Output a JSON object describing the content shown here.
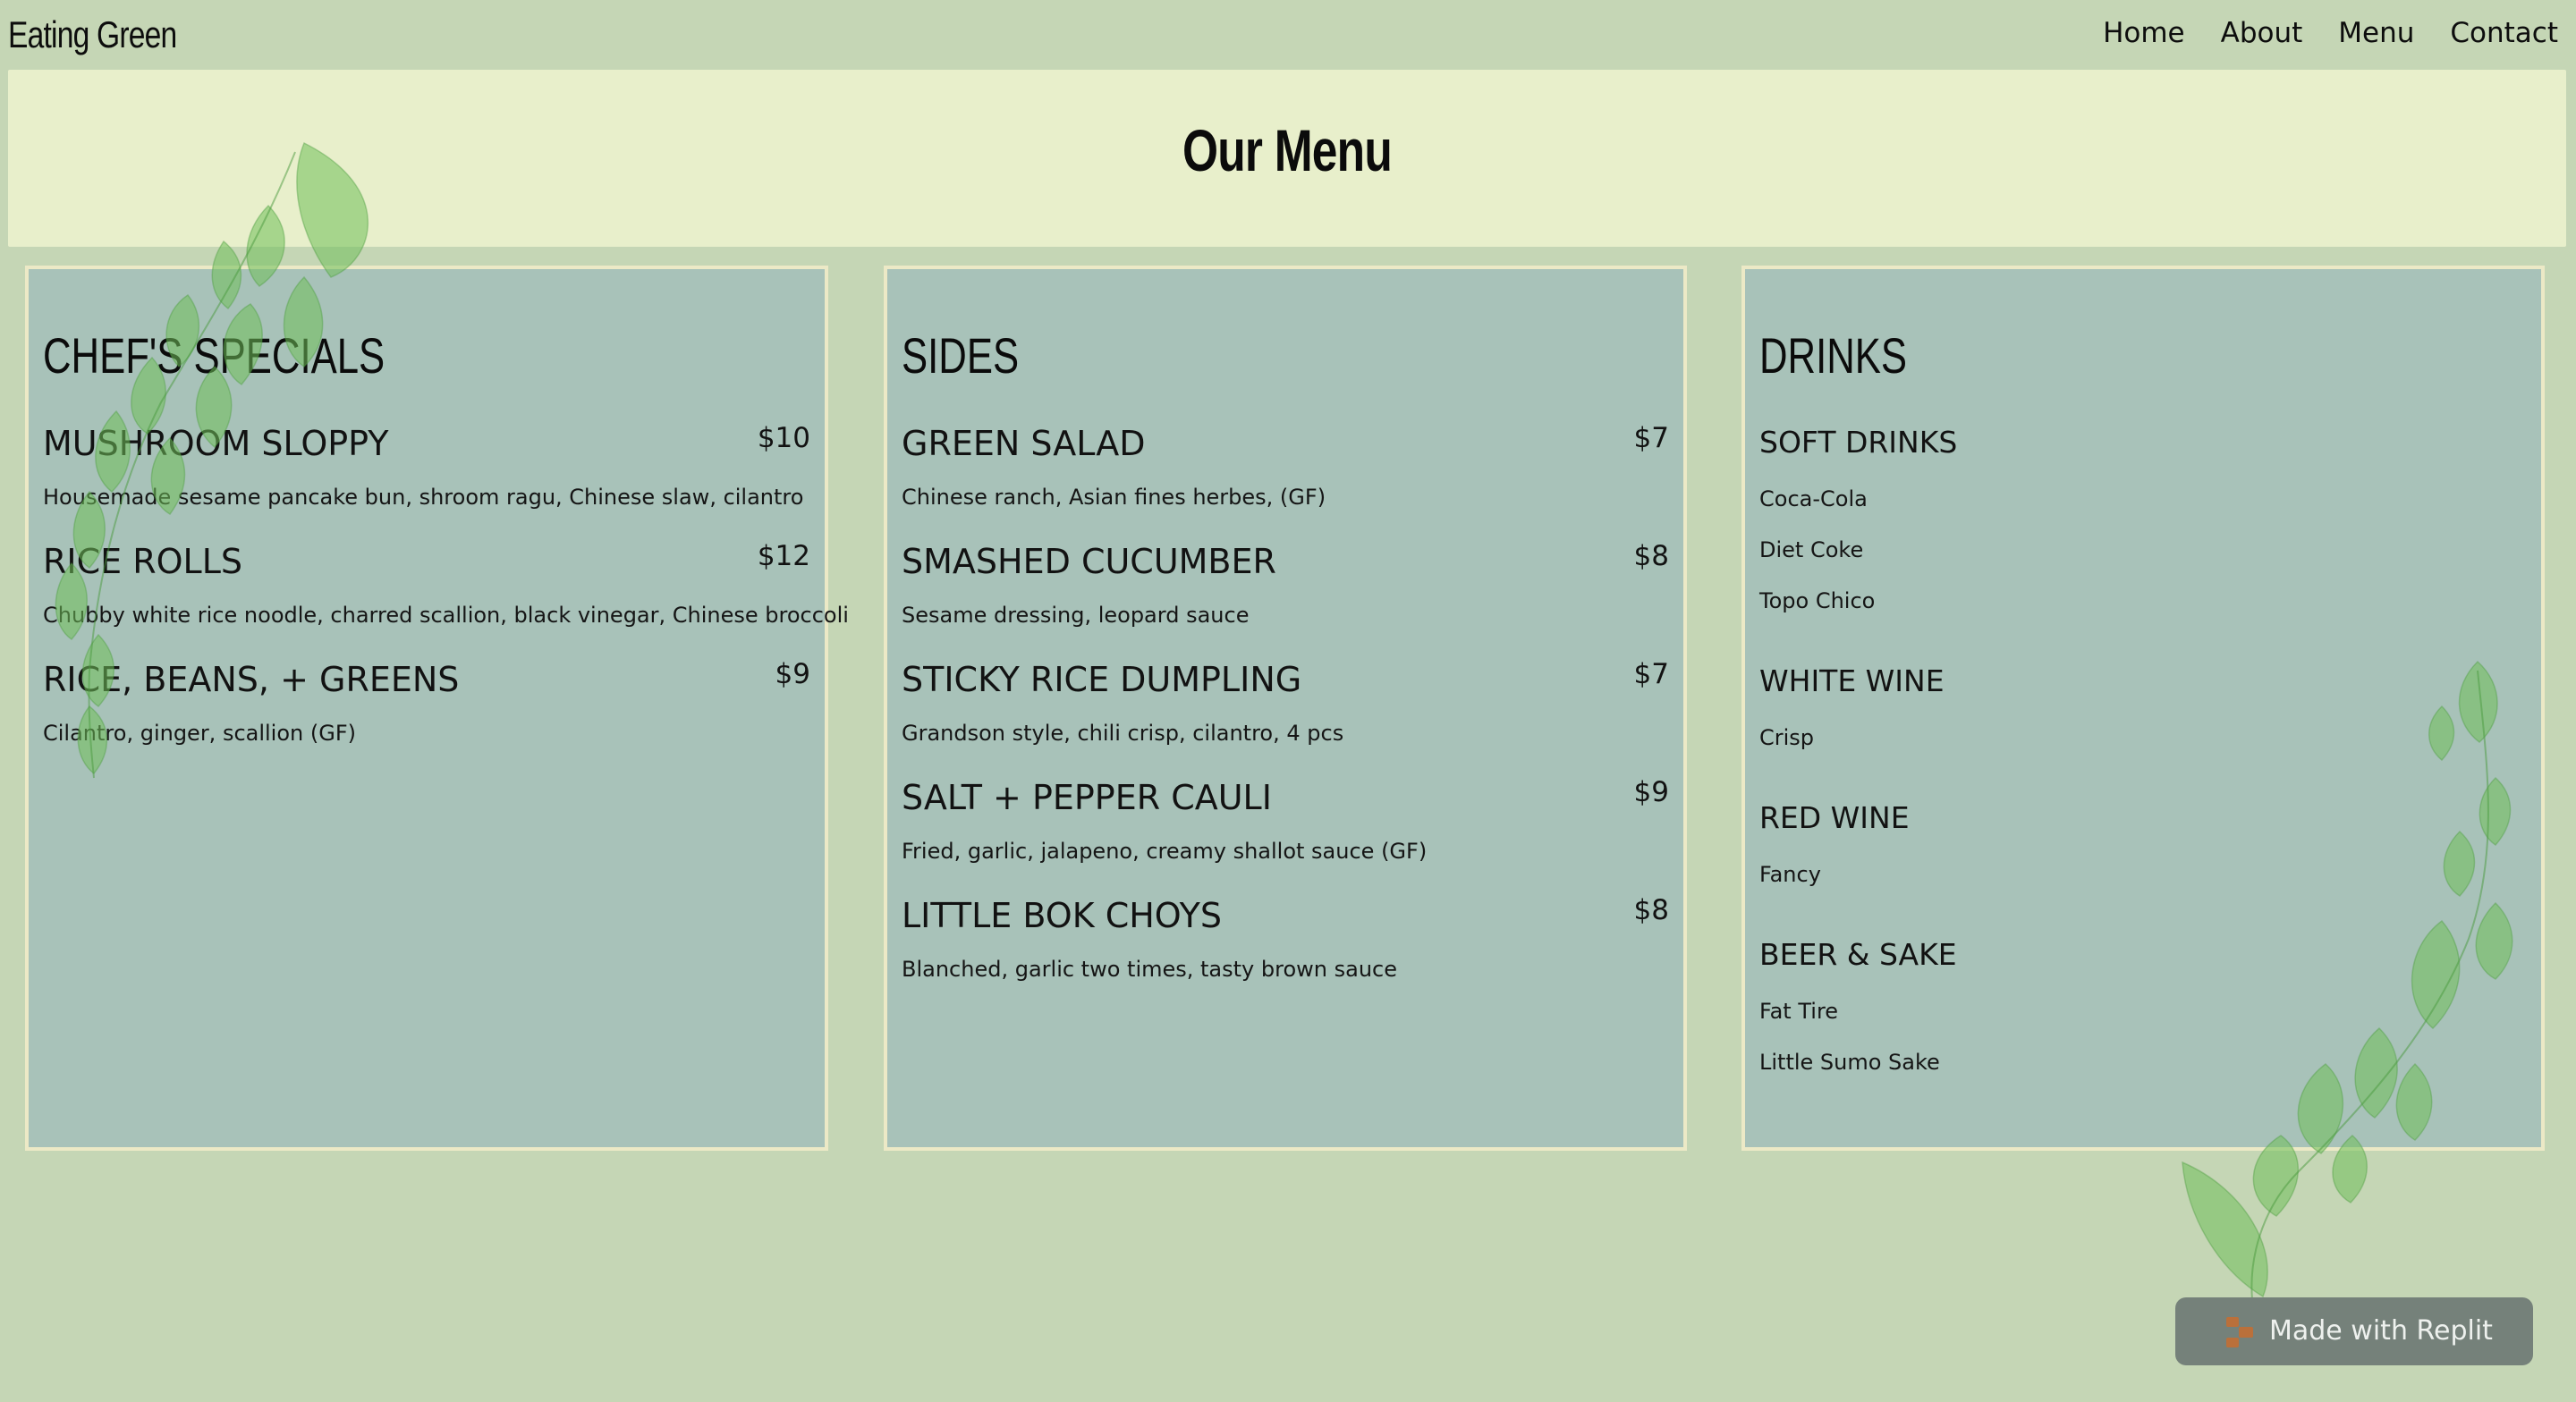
{
  "header": {
    "brand": "Eating Green",
    "nav": [
      "Home",
      "About",
      "Menu",
      "Contact"
    ]
  },
  "hero": {
    "title": "Our Menu"
  },
  "menu": {
    "chefs_specials": {
      "title": "CHEF'S SPECIALS",
      "items": [
        {
          "name": "MUSHROOM SLOPPY",
          "price": "$10",
          "desc": "Housemade sesame pancake bun, shroom ragu, Chinese slaw, cilantro"
        },
        {
          "name": "RICE ROLLS",
          "price": "$12",
          "desc": "Chubby white rice noodle, charred scallion, black vinegar, Chinese broccoli"
        },
        {
          "name": "RICE, BEANS, + GREENS",
          "price": "$9",
          "desc": "Cilantro, ginger, scallion (GF)"
        }
      ]
    },
    "sides": {
      "title": "SIDES",
      "items": [
        {
          "name": "GREEN SALAD",
          "price": "$7",
          "desc": "Chinese ranch, Asian fines herbes, (GF)"
        },
        {
          "name": "SMASHED CUCUMBER",
          "price": "$8",
          "desc": "Sesame dressing, leopard sauce"
        },
        {
          "name": "STICKY RICE DUMPLING",
          "price": "$7",
          "desc": "Grandson style, chili crisp, cilantro, 4 pcs"
        },
        {
          "name": "SALT + PEPPER CAULI",
          "price": "$9",
          "desc": "Fried, garlic, jalapeno, creamy shallot sauce (GF)"
        },
        {
          "name": "LITTLE BOK CHOYS",
          "price": "$8",
          "desc": "Blanched, garlic two times, tasty brown sauce"
        }
      ]
    },
    "drinks": {
      "title": "DRINKS",
      "groups": [
        {
          "title": "SOFT DRINKS",
          "items": [
            "Coca-Cola",
            "Diet Coke",
            "Topo Chico"
          ]
        },
        {
          "title": "WHITE WINE",
          "items": [
            "Crisp"
          ]
        },
        {
          "title": "RED WINE",
          "items": [
            "Fancy"
          ]
        },
        {
          "title": "BEER & SAKE",
          "items": [
            "Fat Tire",
            "Little Sumo Sake"
          ]
        }
      ]
    }
  },
  "badge": {
    "label": "Made with Replit",
    "icon": "replit-logo-icon"
  },
  "colors": {
    "page_bg": "#c5d6b5",
    "hero_bg": "#e8efcb",
    "column_bg": "#a8c2b9",
    "column_border": "#ece9c6",
    "leaf_green": "#6fbf5a",
    "badge_bg": "#75817a",
    "replit_orange": "#f26207"
  }
}
